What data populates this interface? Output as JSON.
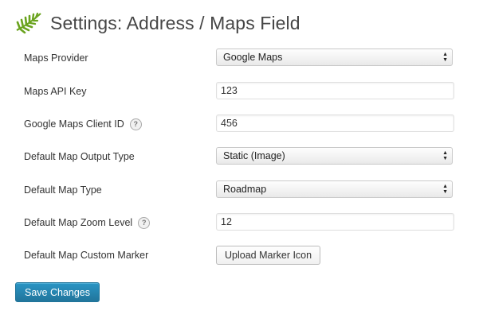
{
  "header": {
    "title": "Settings: Address / Maps Field",
    "logo_icon": "fern-leaf-icon",
    "logo_color": "#6aa31e"
  },
  "fields": {
    "maps_provider": {
      "label": "Maps Provider",
      "value": "Google Maps"
    },
    "api_key": {
      "label": "Maps API Key",
      "value": "123"
    },
    "client_id": {
      "label": "Google Maps Client ID",
      "value": "456",
      "help": "?"
    },
    "output_type": {
      "label": "Default Map Output Type",
      "value": "Static (Image)"
    },
    "map_type": {
      "label": "Default Map Type",
      "value": "Roadmap"
    },
    "zoom_level": {
      "label": "Default Map Zoom Level",
      "value": "12",
      "help": "?"
    },
    "custom_marker": {
      "label": "Default Map Custom Marker",
      "button": "Upload Marker Icon"
    }
  },
  "actions": {
    "save_label": "Save Changes",
    "save_color": "#21759b"
  }
}
